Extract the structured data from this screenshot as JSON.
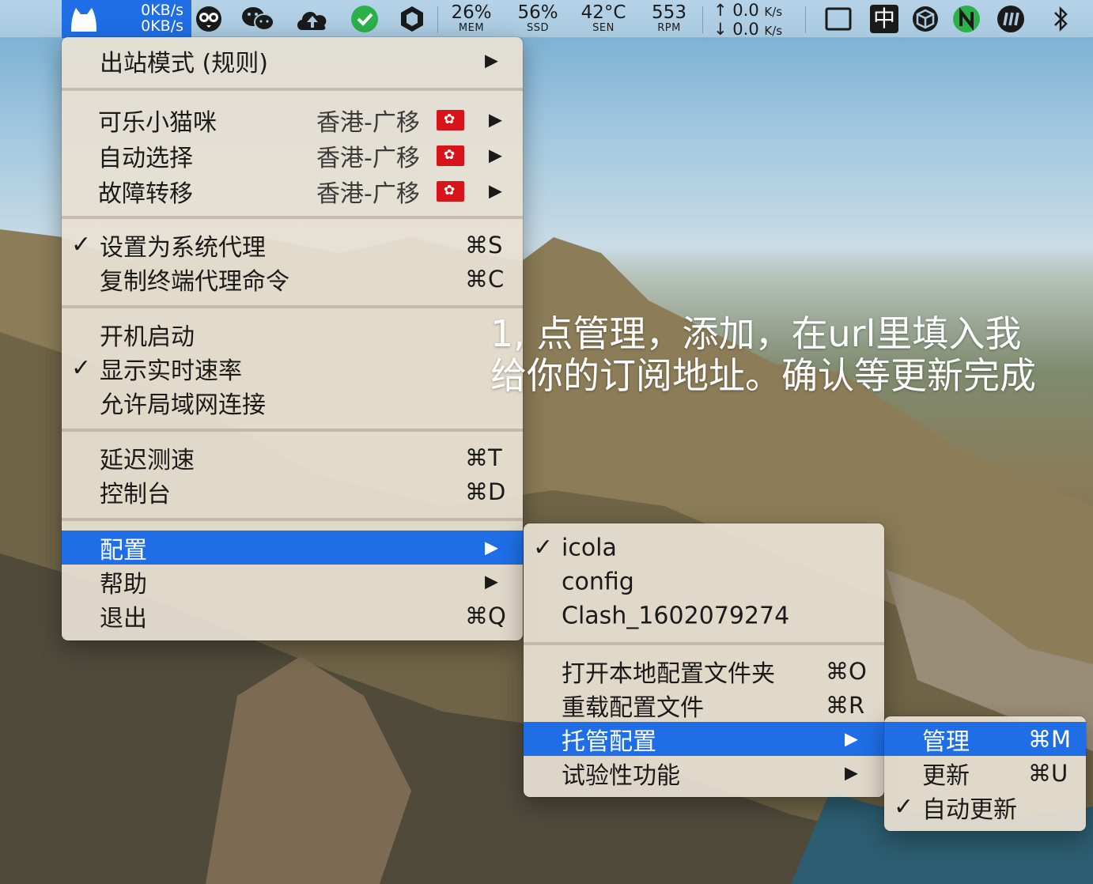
{
  "menubar": {
    "speed_up": "0KB/s",
    "speed_down": "0KB/s",
    "tray_icons": [
      "clashx-cat-icon",
      "owl-icon",
      "wechat-icon",
      "cloud-upload-icon",
      "green-check-icon",
      "hexagon-icon"
    ],
    "stats": [
      {
        "value": "26%",
        "label": "MEM"
      },
      {
        "value": "56%",
        "label": "SSD"
      },
      {
        "value": "42°C",
        "label": "SEN"
      },
      {
        "value": "553",
        "label": "RPM"
      }
    ],
    "net_up": "0.0",
    "net_down": "0.0",
    "net_unit": "K/s",
    "right_icons": [
      "window-icon",
      "chinese-input-icon",
      "cube-icon",
      "n-icon",
      "lines-icon",
      "bluetooth-icon"
    ],
    "ime_char": "中"
  },
  "main_menu": {
    "outbound_mode": "出站模式 (规则)",
    "proxy_groups": [
      {
        "name": "可乐小猫咪",
        "selected": "香港-广移"
      },
      {
        "name": "自动选择",
        "selected": "香港-广移"
      },
      {
        "name": "故障转移",
        "selected": "香港-广移"
      }
    ],
    "set_system_proxy": "设置为系统代理",
    "set_system_proxy_shortcut": "⌘S",
    "copy_terminal_cmd": "复制终端代理命令",
    "copy_terminal_cmd_shortcut": "⌘C",
    "launch_at_login": "开机启动",
    "show_speed": "显示实时速率",
    "allow_lan": "允许局域网连接",
    "latency_test": "延迟测速",
    "latency_test_shortcut": "⌘T",
    "dashboard": "控制台",
    "dashboard_shortcut": "⌘D",
    "config": "配置",
    "help": "帮助",
    "quit": "退出",
    "quit_shortcut": "⌘Q"
  },
  "config_menu": {
    "profiles": [
      "icola",
      "config",
      "Clash_1602079274"
    ],
    "open_folder": "打开本地配置文件夹",
    "open_folder_shortcut": "⌘O",
    "reload": "重载配置文件",
    "reload_shortcut": "⌘R",
    "remote_config": "托管配置",
    "experimental": "试验性功能"
  },
  "remote_menu": {
    "manage": "管理",
    "manage_shortcut": "⌘M",
    "update": "更新",
    "update_shortcut": "⌘U",
    "auto_update": "自动更新"
  },
  "overlay": {
    "line1": "1,  点管理，添加，在url里填入我",
    "line2": "给你的订阅地址。确认等更新完成"
  },
  "colors": {
    "highlight": "#1f6ee6",
    "menu_bg": "#e8e1d3",
    "check_green": "#2bb04a",
    "flag_red": "#d7141a"
  }
}
